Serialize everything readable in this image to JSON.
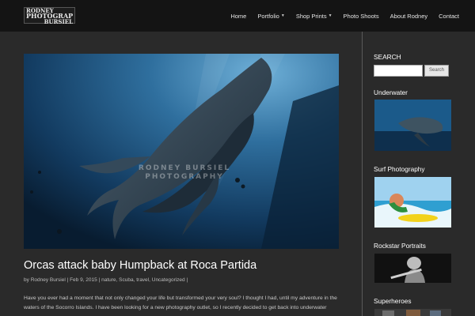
{
  "header": {
    "logo_line1": "RODNEY",
    "logo_line2": "PHOTOGRAPHY",
    "logo_line3": "BURSIEL",
    "nav": [
      {
        "label": "Home",
        "dropdown": false
      },
      {
        "label": "Portfolio",
        "dropdown": true
      },
      {
        "label": "Shop Prints",
        "dropdown": true
      },
      {
        "label": "Photo Shoots",
        "dropdown": false
      },
      {
        "label": "About Rodney",
        "dropdown": false
      },
      {
        "label": "Contact",
        "dropdown": false
      }
    ]
  },
  "post": {
    "image_watermark_line1": "RODNEY BURSIEL",
    "image_watermark_line2": "PHOTOGRAPHY",
    "title": "Orcas attack baby Humpback at Roca Partida",
    "meta_by": "by",
    "author": "Rodney Bursiel",
    "date": "Feb 9, 2015",
    "categories": [
      "nature",
      "Scuba",
      "travel",
      "Uncategorized"
    ],
    "excerpt": "Have you ever had a moment that not only changed your life but transformed your very soul? I thought I had, until my adventure in the waters of the Socorro Islands. I have been looking for a new photography outlet, so I recently decided to get back into underwater"
  },
  "sidebar": {
    "search_title": "SEARCH",
    "search_value": "",
    "search_button": "Search",
    "widgets": [
      {
        "title": "Underwater",
        "icon": "whale-thumbnail"
      },
      {
        "title": "Surf Photography",
        "icon": "surfer-thumbnail"
      },
      {
        "title": "Rockstar Portraits",
        "icon": "guitarist-thumbnail"
      },
      {
        "title": "Superheroes",
        "icon": "superheroes-thumbnail"
      }
    ]
  },
  "colors": {
    "page_bg": "#2a2a2a",
    "header_bg": "#141414",
    "ocean_deep": "#0b2a47",
    "ocean_light": "#3f83b3"
  }
}
